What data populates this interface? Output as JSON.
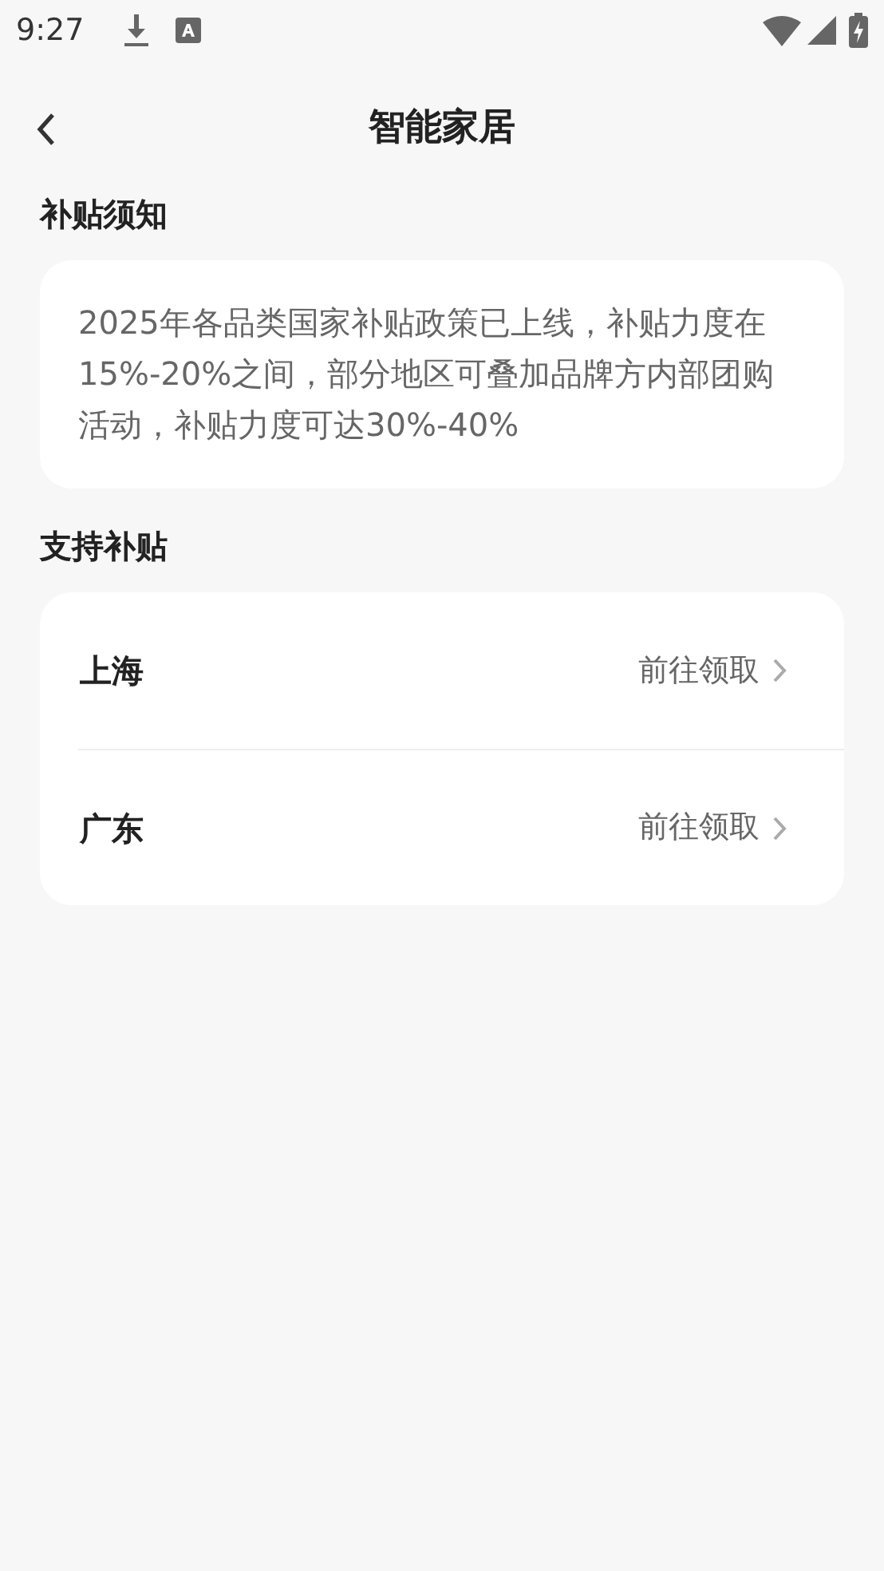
{
  "status_bar": {
    "time": "9:27"
  },
  "header": {
    "title": "智能家居"
  },
  "notice": {
    "heading": "补贴须知",
    "text": "2025年各品类国家补贴政策已上线，补贴力度在15%-20%之间，部分地区可叠加品牌方内部团购活动，补贴力度可达30%-40%"
  },
  "support": {
    "heading": "支持补贴",
    "items": [
      {
        "name": "上海",
        "action": "前往领取"
      },
      {
        "name": "广东",
        "action": "前往领取"
      }
    ]
  }
}
